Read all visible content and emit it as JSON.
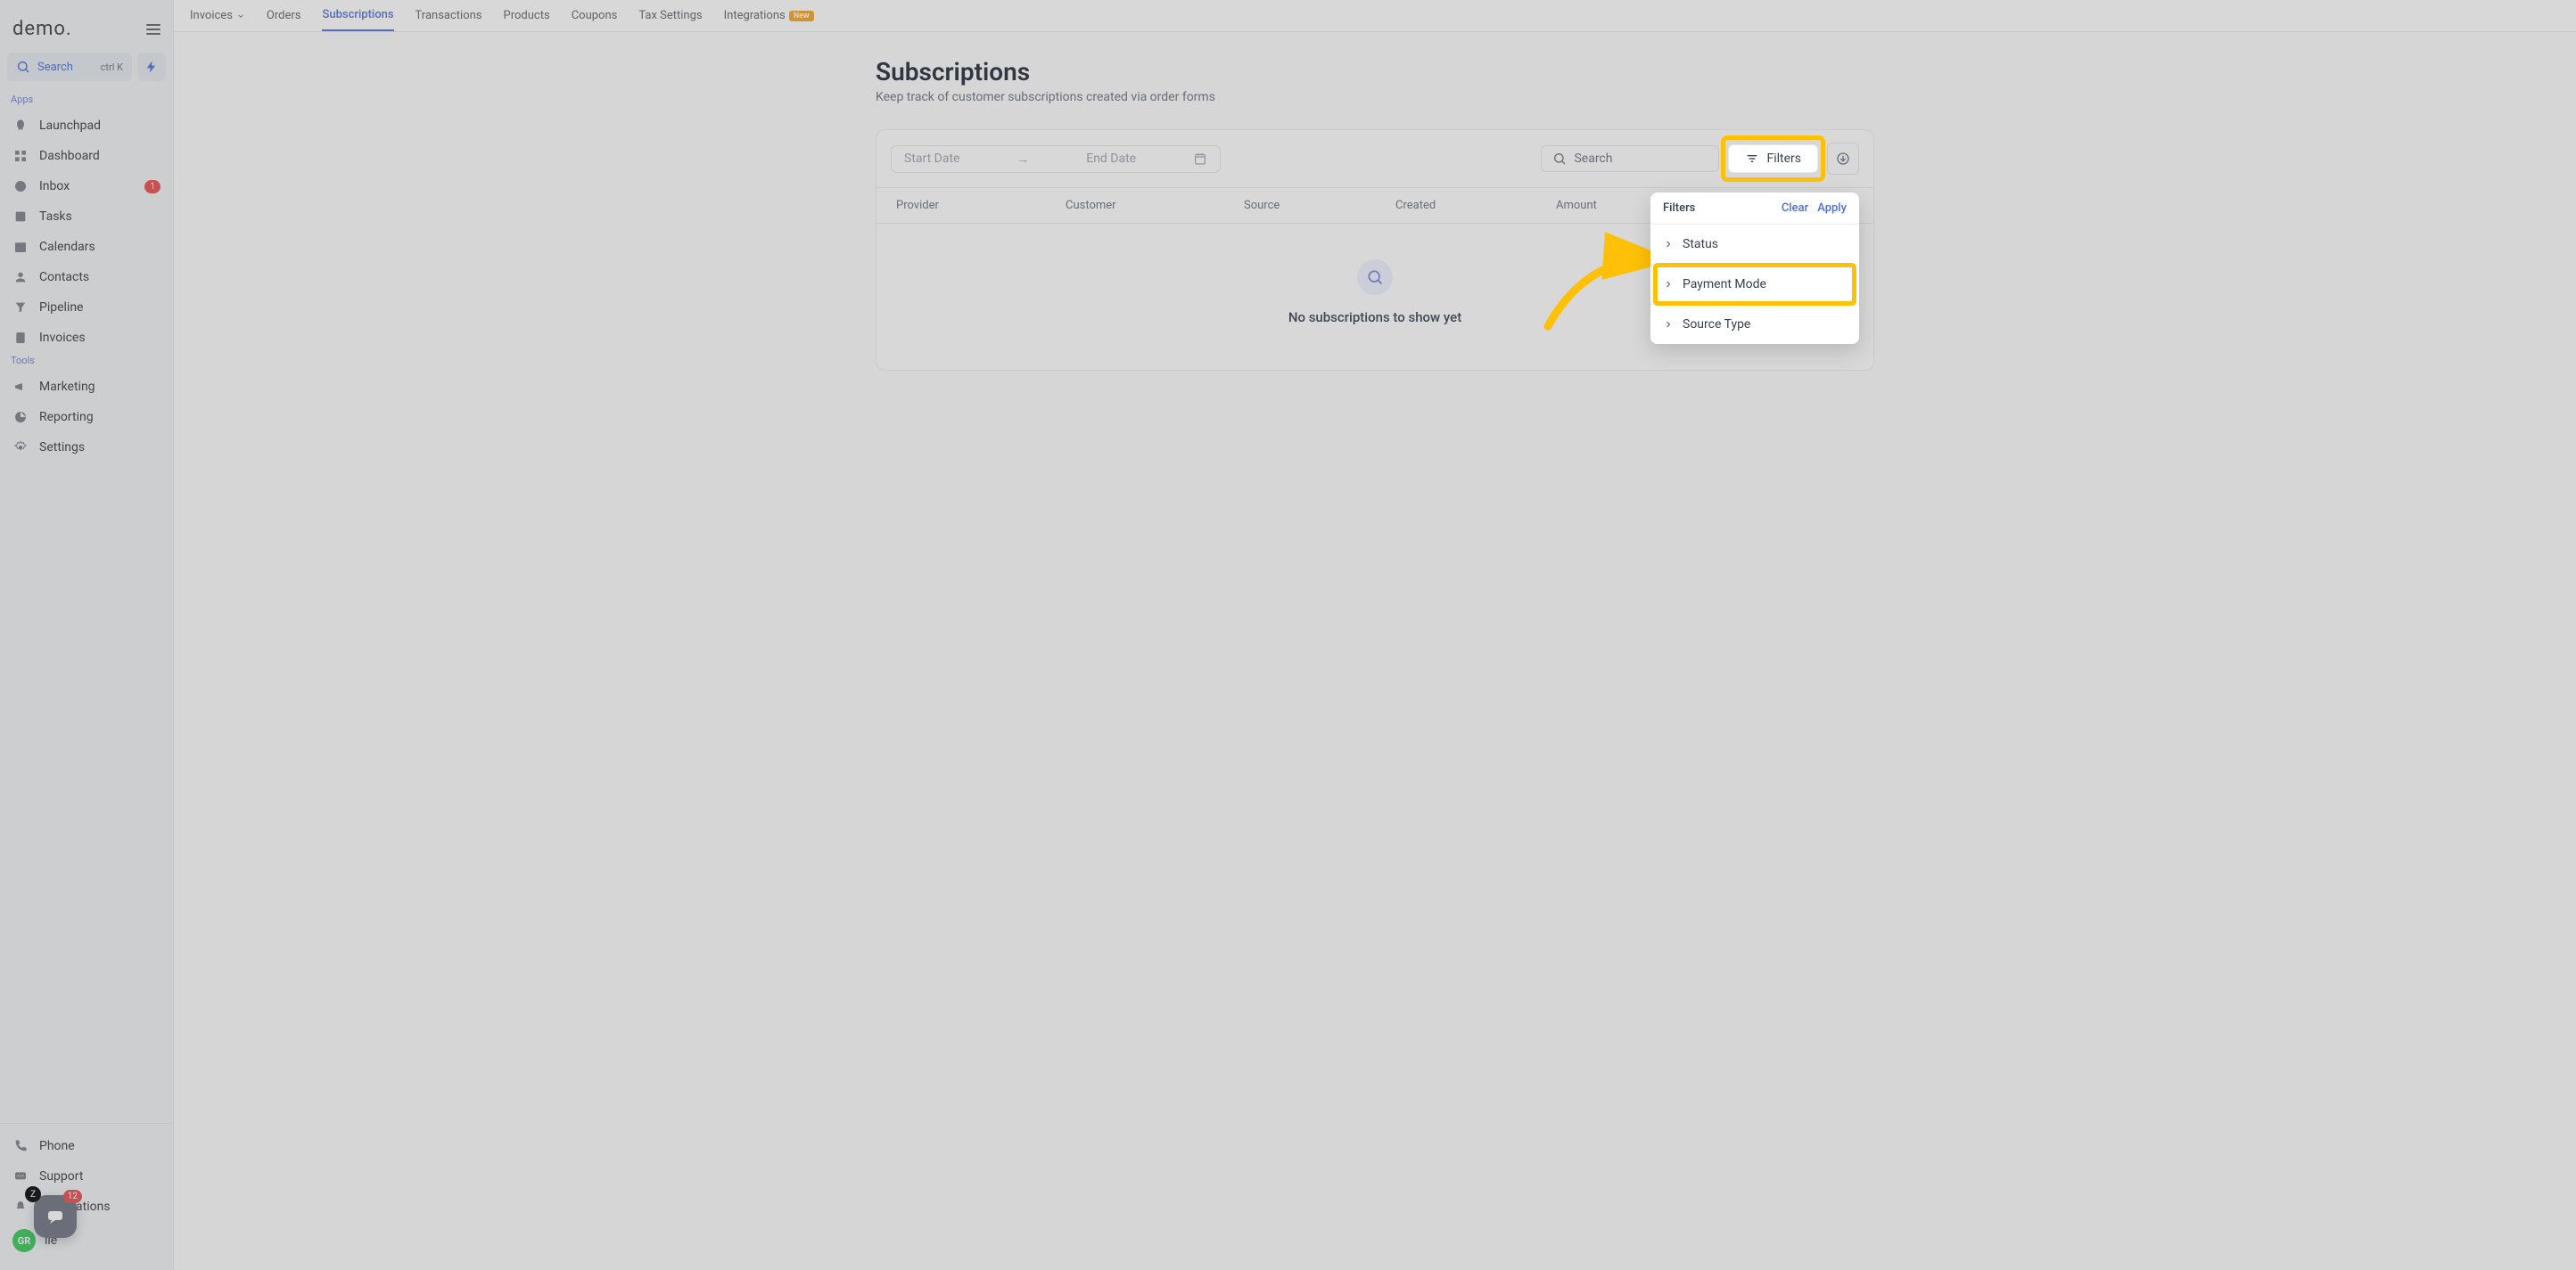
{
  "logo": "demo.",
  "search": {
    "label": "Search",
    "shortcut": "ctrl K"
  },
  "sections": {
    "apps_label": "Apps",
    "tools_label": "Tools"
  },
  "nav": {
    "launchpad": "Launchpad",
    "dashboard": "Dashboard",
    "inbox": "Inbox",
    "inbox_badge": "1",
    "tasks": "Tasks",
    "calendars": "Calendars",
    "contacts": "Contacts",
    "pipeline": "Pipeline",
    "invoices": "Invoices",
    "marketing": "Marketing",
    "reporting": "Reporting",
    "settings": "Settings"
  },
  "footer": {
    "phone": "Phone",
    "support": "Support",
    "notifications": "Notifications",
    "profile_suffix": "ile",
    "avatar_initials": "GR"
  },
  "support_bubble": {
    "z_badge": "Z",
    "notif_count": "12"
  },
  "topnav": {
    "invoices": "Invoices",
    "orders": "Orders",
    "subscriptions": "Subscriptions",
    "transactions": "Transactions",
    "products": "Products",
    "coupons": "Coupons",
    "tax_settings": "Tax Settings",
    "integrations": "Integrations",
    "new_badge": "New"
  },
  "page": {
    "title": "Subscriptions",
    "subtitle": "Keep track of customer subscriptions created via order forms"
  },
  "toolbar": {
    "start_date": "Start Date",
    "end_date": "End Date",
    "search_placeholder": "Search",
    "filters_label": "Filters"
  },
  "columns": {
    "provider": "Provider",
    "customer": "Customer",
    "source": "Source",
    "created": "Created",
    "amount": "Amount"
  },
  "empty_state": "No subscriptions to show yet",
  "filters_popover": {
    "title": "Filters",
    "clear": "Clear",
    "apply": "Apply",
    "status": "Status",
    "payment_mode": "Payment Mode",
    "source_type": "Source Type"
  }
}
